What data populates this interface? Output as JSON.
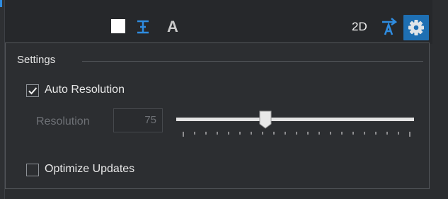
{
  "toolbar": {
    "view_mode_label": "2D",
    "font_icon_glyph": "A",
    "icons": [
      "color-swatch-icon",
      "fit-width-icon",
      "font-icon",
      "auto-font-size-icon",
      "gear-icon"
    ],
    "colors": {
      "swatch": "#ffffff",
      "accent": "#2f8ce0",
      "gear_bg": "#1e6fb3"
    }
  },
  "settings": {
    "title": "Settings",
    "auto_resolution": {
      "label": "Auto Resolution",
      "checked": true
    },
    "resolution": {
      "label": "Resolution",
      "value": "75",
      "slider_fraction": 0.375,
      "enabled": false
    },
    "optimize_updates": {
      "label": "Optimize Updates",
      "checked": false
    }
  }
}
